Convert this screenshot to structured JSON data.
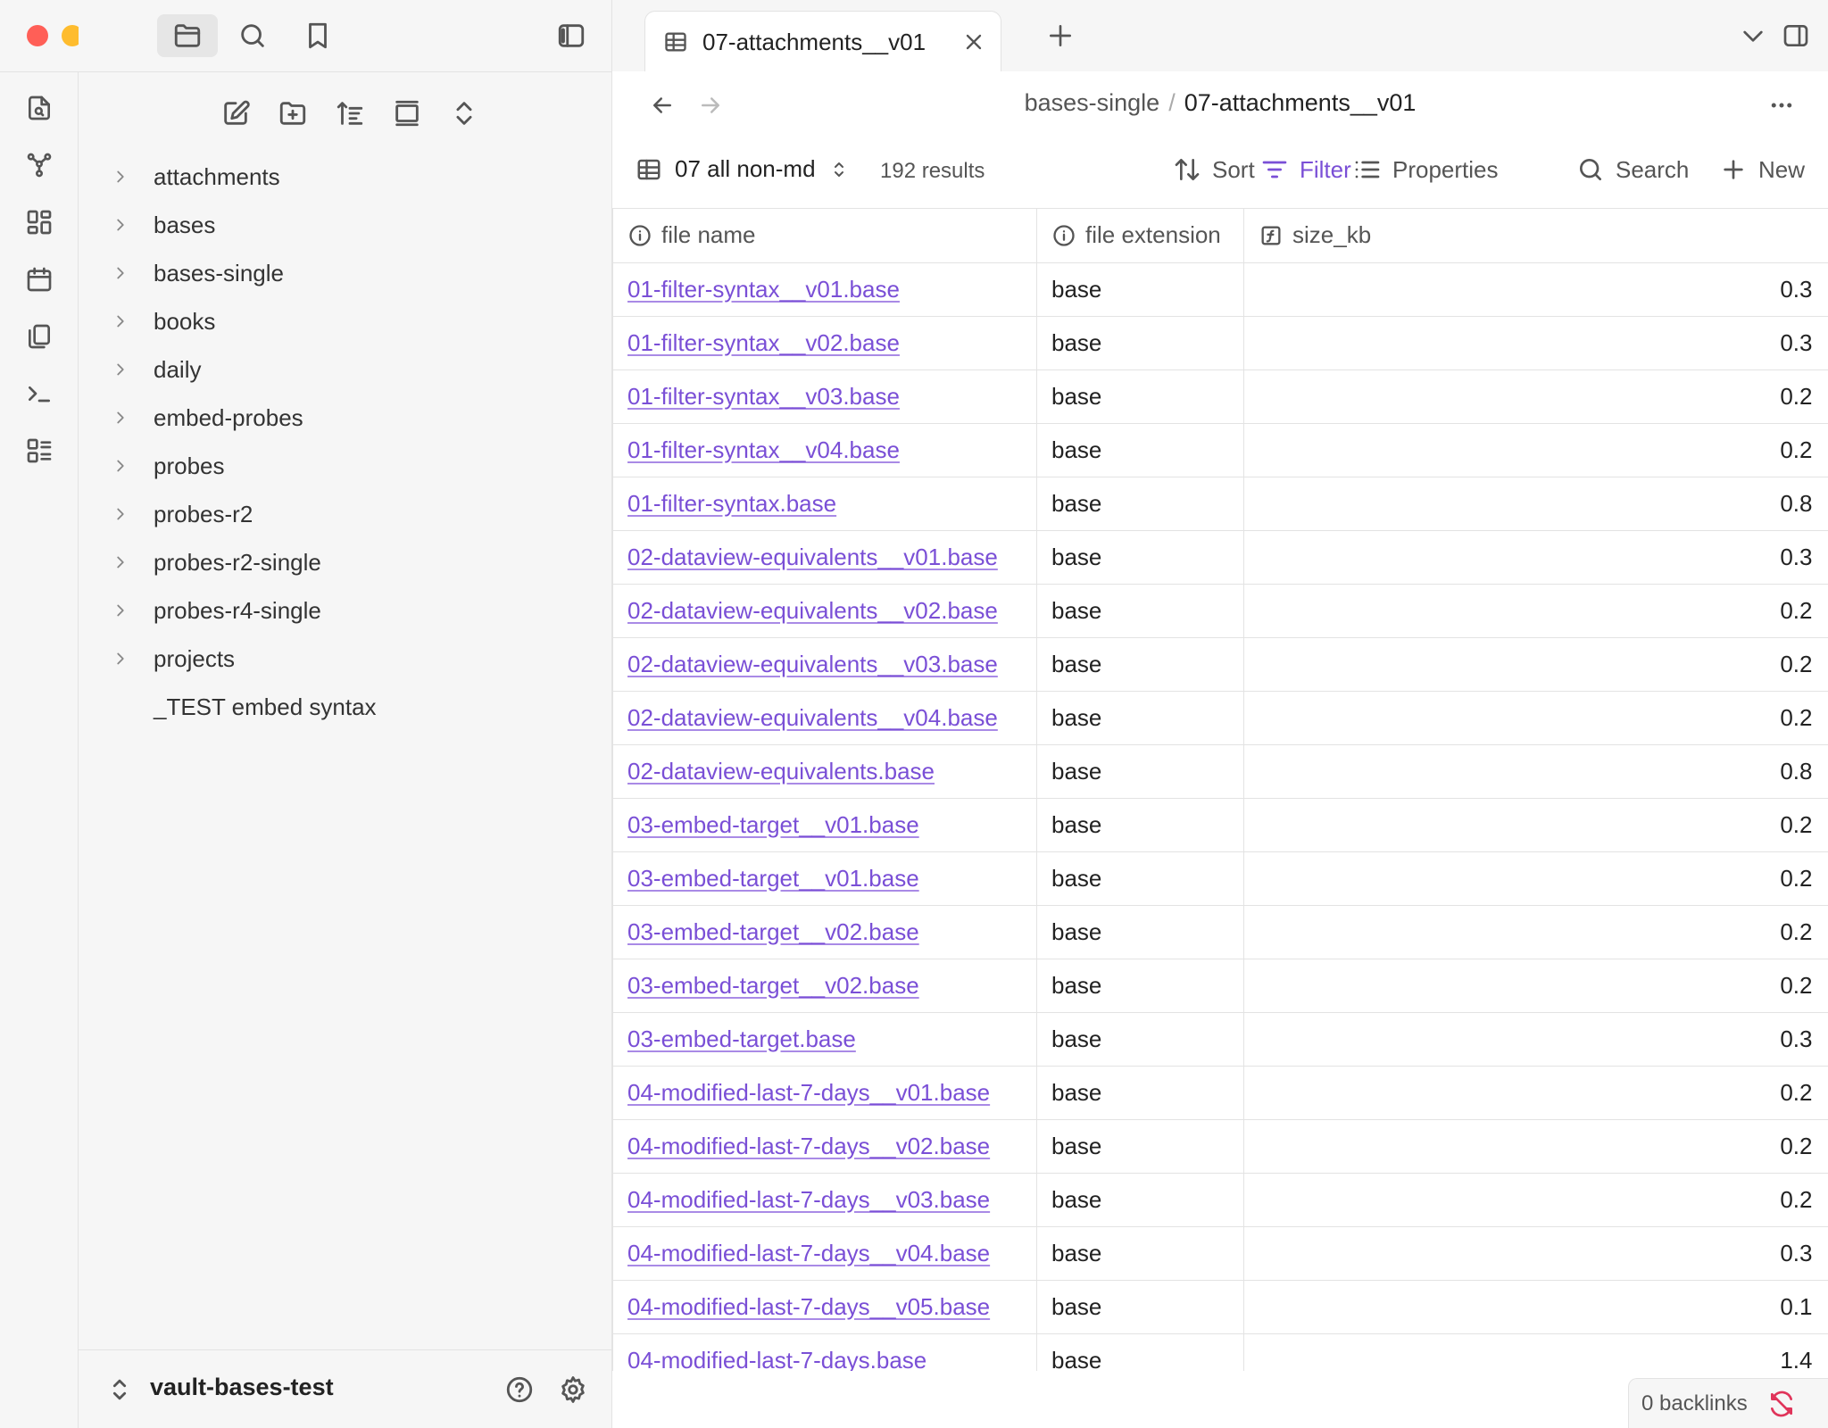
{
  "window": {
    "traffic_colors": {
      "close": "#ff5f57",
      "minimize": "#febc2e",
      "maximize": "#28c840"
    }
  },
  "ribbon": {
    "items": [
      "open-quick-switcher-icon",
      "graph-view-icon",
      "canvas-icon",
      "daily-notes-icon",
      "templates-icon",
      "command-palette-icon",
      "bases-icon"
    ]
  },
  "sidebar": {
    "tabs": [
      "files-icon",
      "search-icon",
      "bookmarks-icon"
    ],
    "nav_actions": [
      "new-note-icon",
      "new-folder-icon",
      "sort-icon",
      "collapse-icon",
      "expand-icon"
    ],
    "tree": [
      {
        "label": "attachments",
        "type": "folder"
      },
      {
        "label": "bases",
        "type": "folder"
      },
      {
        "label": "bases-single",
        "type": "folder"
      },
      {
        "label": "books",
        "type": "folder"
      },
      {
        "label": "daily",
        "type": "folder"
      },
      {
        "label": "embed-probes",
        "type": "folder"
      },
      {
        "label": "probes",
        "type": "folder"
      },
      {
        "label": "probes-r2",
        "type": "folder"
      },
      {
        "label": "probes-r2-single",
        "type": "folder"
      },
      {
        "label": "probes-r4-single",
        "type": "folder"
      },
      {
        "label": "projects",
        "type": "folder"
      },
      {
        "label": "_TEST embed syntax",
        "type": "file"
      }
    ],
    "vault_name": "vault-bases-test"
  },
  "tab": {
    "title": "07-attachments__v01"
  },
  "breadcrumb": {
    "parent": "bases-single",
    "separator": "/",
    "current": "07-attachments__v01"
  },
  "toolbar": {
    "view_name": "07 all non-md",
    "results": "192 results",
    "sort": "Sort",
    "filter": "Filter",
    "properties": "Properties",
    "search": "Search",
    "new": "New",
    "accent_color": "#7a4fd6"
  },
  "table": {
    "columns": [
      "file name",
      "file extension",
      "size_kb"
    ],
    "rows": [
      [
        "01-filter-syntax__v01.base",
        "base",
        "0.3"
      ],
      [
        "01-filter-syntax__v02.base",
        "base",
        "0.3"
      ],
      [
        "01-filter-syntax__v03.base",
        "base",
        "0.2"
      ],
      [
        "01-filter-syntax__v04.base",
        "base",
        "0.2"
      ],
      [
        "01-filter-syntax.base",
        "base",
        "0.8"
      ],
      [
        "02-dataview-equivalents__v01.base",
        "base",
        "0.3"
      ],
      [
        "02-dataview-equivalents__v02.base",
        "base",
        "0.2"
      ],
      [
        "02-dataview-equivalents__v03.base",
        "base",
        "0.2"
      ],
      [
        "02-dataview-equivalents__v04.base",
        "base",
        "0.2"
      ],
      [
        "02-dataview-equivalents.base",
        "base",
        "0.8"
      ],
      [
        "03-embed-target__v01.base",
        "base",
        "0.2"
      ],
      [
        "03-embed-target__v01.base",
        "base",
        "0.2"
      ],
      [
        "03-embed-target__v02.base",
        "base",
        "0.2"
      ],
      [
        "03-embed-target__v02.base",
        "base",
        "0.2"
      ],
      [
        "03-embed-target.base",
        "base",
        "0.3"
      ],
      [
        "04-modified-last-7-days__v01.base",
        "base",
        "0.2"
      ],
      [
        "04-modified-last-7-days__v02.base",
        "base",
        "0.2"
      ],
      [
        "04-modified-last-7-days__v03.base",
        "base",
        "0.2"
      ],
      [
        "04-modified-last-7-days__v04.base",
        "base",
        "0.3"
      ],
      [
        "04-modified-last-7-days__v05.base",
        "base",
        "0.1"
      ],
      [
        "04-modified-last-7-days.base",
        "base",
        "1.4"
      ]
    ]
  },
  "status": {
    "backlinks": "0 backlinks"
  }
}
